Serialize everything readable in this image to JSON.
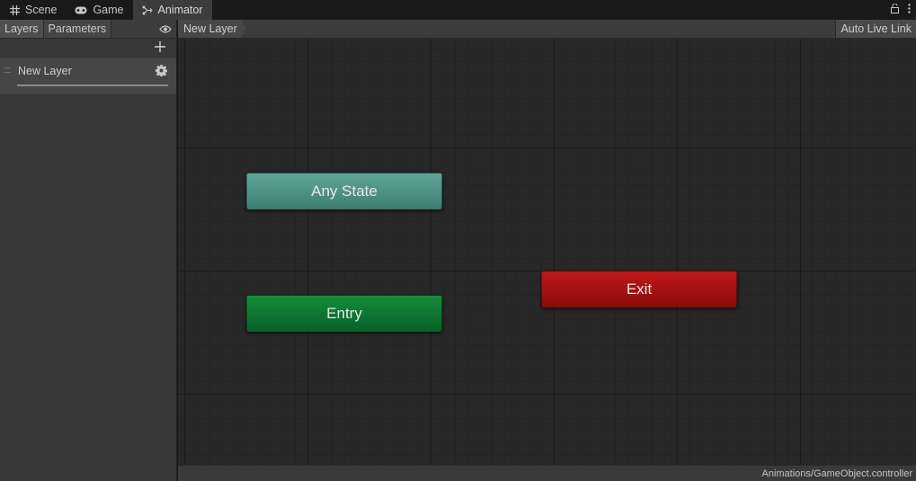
{
  "tabs": [
    {
      "label": "Scene",
      "icon": "grid-icon",
      "active": false
    },
    {
      "label": "Game",
      "icon": "gamepad-icon",
      "active": false
    },
    {
      "label": "Animator",
      "icon": "animator-icon",
      "active": true
    }
  ],
  "left_panel": {
    "tabs": [
      {
        "label": "Layers",
        "selected": true
      },
      {
        "label": "Parameters",
        "selected": false
      }
    ],
    "layers": [
      {
        "name": "New Layer"
      }
    ]
  },
  "graph": {
    "breadcrumb": "New Layer",
    "auto_live_link": "Auto Live Link",
    "nodes": {
      "any_state": {
        "label": "Any State",
        "color": "#4f9285"
      },
      "entry": {
        "label": "Entry",
        "color": "#0f7632"
      },
      "exit": {
        "label": "Exit",
        "color": "#a51111"
      }
    }
  },
  "status": {
    "path": "Animations/GameObject.controller"
  }
}
